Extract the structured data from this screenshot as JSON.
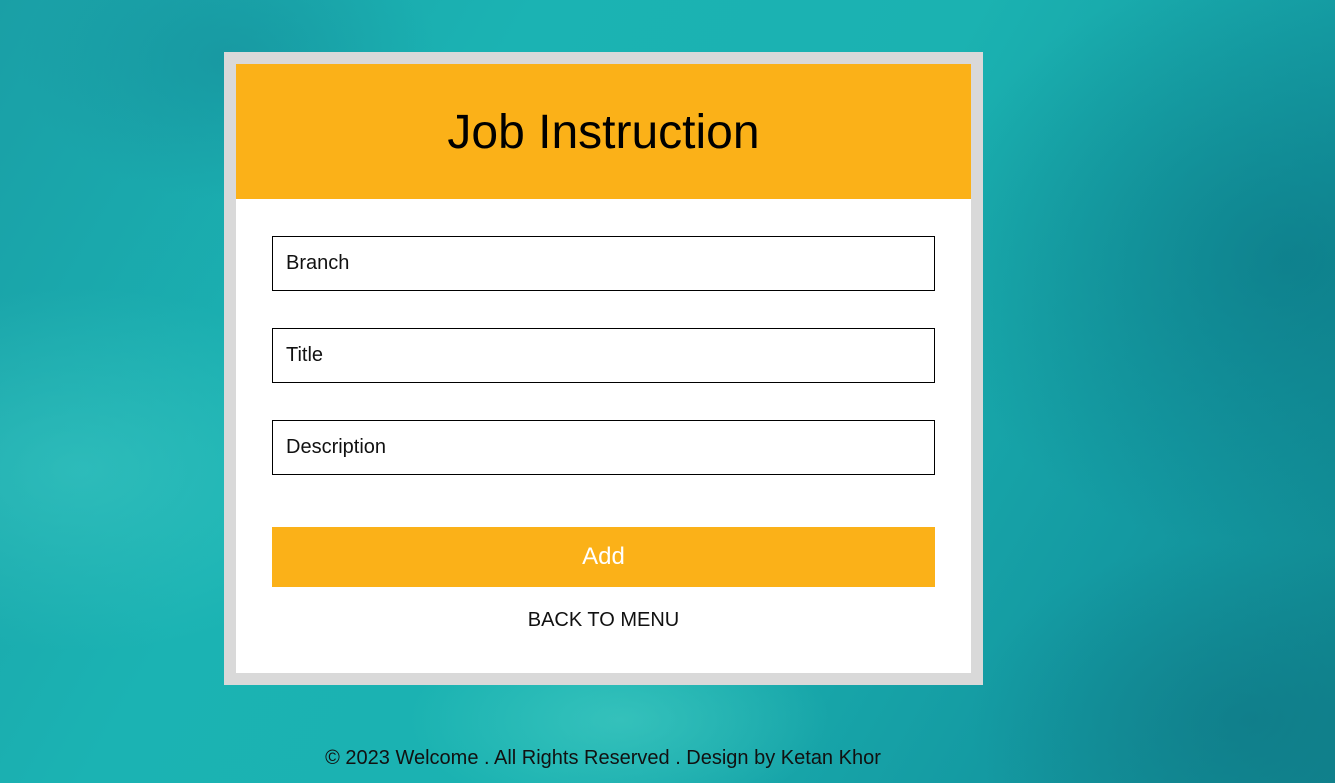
{
  "form": {
    "title": "Job Instruction",
    "fields": {
      "branch": {
        "placeholder": "Branch",
        "value": ""
      },
      "title": {
        "placeholder": "Title",
        "value": ""
      },
      "description": {
        "placeholder": "Description",
        "value": ""
      }
    },
    "add_label": "Add",
    "back_label": "BACK TO MENU"
  },
  "footer": {
    "text": "© 2023 Welcome . All Rights Reserved . Design by Ketan Khor"
  },
  "colors": {
    "accent": "#fbb118",
    "frame": "#d9d9d9",
    "background": "#1bb2b1"
  }
}
